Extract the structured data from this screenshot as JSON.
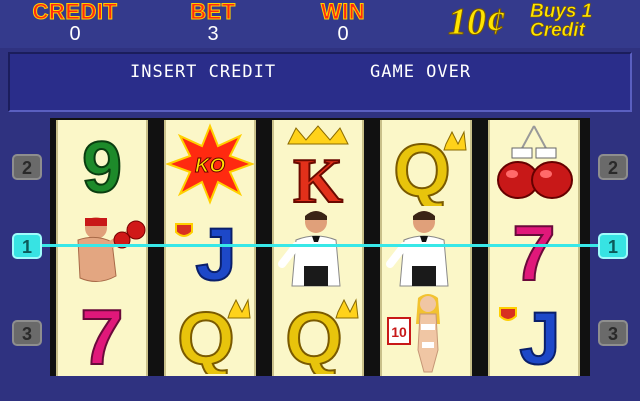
{
  "meters": {
    "credit_label": "CREDIT",
    "credit_value": "0",
    "bet_label": "BET",
    "bet_value": "3",
    "win_label": "WIN",
    "win_value": "0"
  },
  "denomination": {
    "amount": "10¢",
    "text_line1": "Buys 1",
    "text_line2": "Credit"
  },
  "messages": {
    "insert": "INSERT CREDIT",
    "status": "GAME OVER"
  },
  "paylines": {
    "left": [
      "2",
      "1",
      "3"
    ],
    "right": [
      "2",
      "1",
      "3"
    ],
    "active": "1"
  },
  "reels": [
    [
      "nine",
      "boxer",
      "seven"
    ],
    [
      "ko-burst",
      "jack",
      "queen"
    ],
    [
      "king",
      "referee",
      "queen"
    ],
    [
      "queen",
      "referee",
      "ring-girl"
    ],
    [
      "boxing-gloves",
      "seven",
      "jack"
    ]
  ],
  "symbol_text": {
    "nine": "9",
    "seven": "7",
    "jack": "J",
    "queen": "Q",
    "king": "K",
    "ko": "KO",
    "ring_card": "10"
  },
  "colors": {
    "accent_cyan": "#37e3e3",
    "panel_blue": "#2f3280",
    "reel_bg": "#fbf7c8"
  }
}
